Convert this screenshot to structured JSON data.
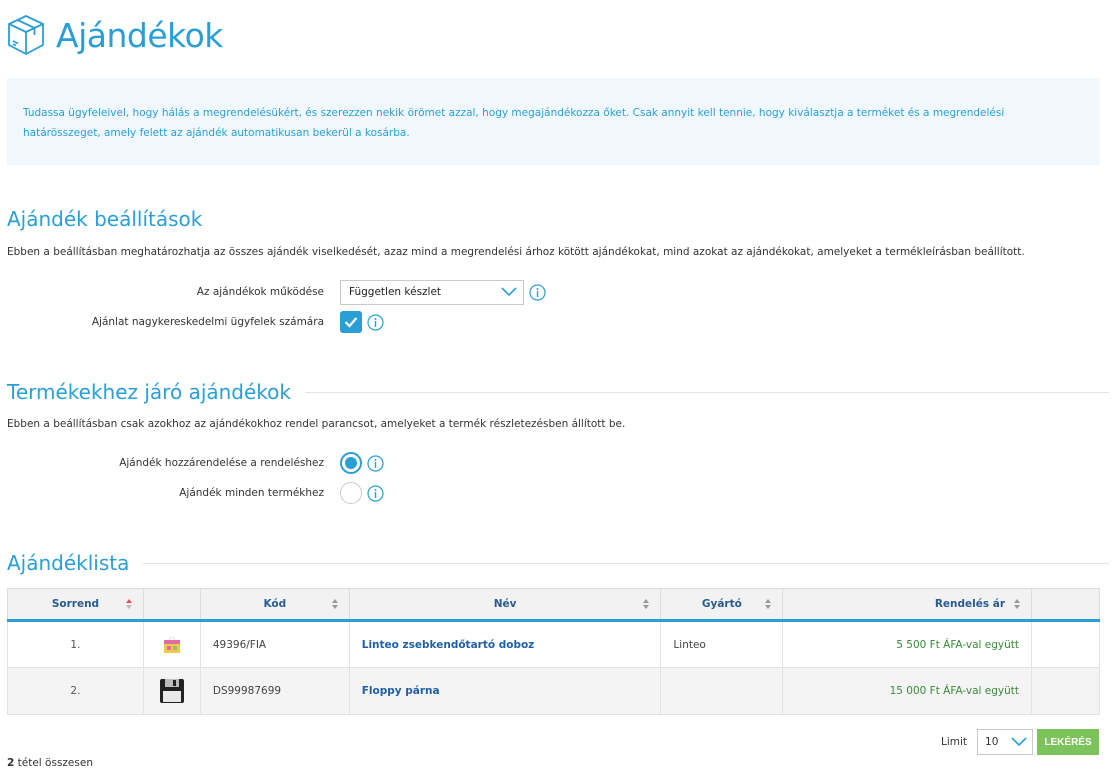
{
  "header": {
    "title": "Ajándékok",
    "icon": "box-icon"
  },
  "info": {
    "text": "Tudassa ügyfeleivel, hogy hálás a megrendelésükért, és szerezzen nekik örömet azzal, hogy megajándékozza őket. Csak annyit kell tennie, hogy kiválasztja a terméket és a megrendelési határösszeget, amely felett az ajándék automatikusan bekerül a kosárba."
  },
  "gift_settings": {
    "title": "Ajándék beállítások",
    "description": "Ebben a beállításban meghatározhatja az összes ajándék viselkedését, azaz mind a megrendelési árhoz kötött ajándékokat, mind azokat az ajándékokat, amelyeket a termékleírásban beállított.",
    "operation_label": "Az ajándékok működése",
    "operation_value": "Független készlet",
    "wholesale_label": "Ajánlat nagykereskedelmi ügyfelek számára",
    "wholesale_checked": true
  },
  "product_gifts": {
    "title": "Termékekhez járó ajándékok",
    "description": "Ebben a beállításban csak azokhoz az ajándékokhoz rendel parancsot, amelyeket a termék részletezésben állított be.",
    "option1_label": "Ajándék hozzárendelése a rendeléshez",
    "option2_label": "Ajándék minden termékhez",
    "selected": 1
  },
  "gift_list": {
    "title": "Ajándéklista",
    "columns": {
      "order": "Sorrend",
      "code": "Kód",
      "name": "Név",
      "maker": "Gyártó",
      "price": "Rendelés ár"
    },
    "rows": [
      {
        "order": "1.",
        "code": "49396/FIA",
        "name": "Linteo zsebkendőtartó doboz",
        "maker": "Linteo",
        "price": "5 500 Ft ÁFA-val együtt",
        "image": "tissue-box-thumbnail"
      },
      {
        "order": "2.",
        "code": "DS99987699",
        "name": "Floppy párna",
        "maker": "",
        "price": "15 000 Ft ÁFA-val együtt",
        "image": "floppy-pillow-thumbnail"
      }
    ]
  },
  "pager": {
    "limit_label": "Limit",
    "limit_value": "10",
    "query_button": "LEKÉRÉS"
  },
  "footer": {
    "total_count": "2",
    "total_suffix": " tétel összesen"
  },
  "colors": {
    "accent": "#2a9fd6",
    "green": "#7bc35a",
    "price": "#3a8a3a"
  }
}
